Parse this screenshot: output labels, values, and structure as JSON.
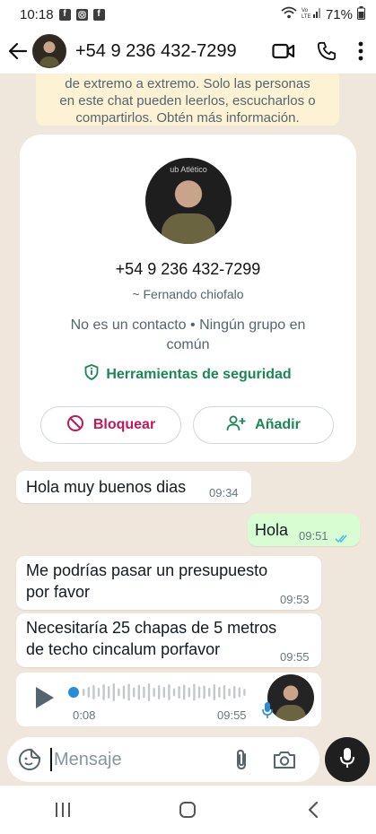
{
  "status_bar": {
    "time": "10:18",
    "battery": "71%"
  },
  "header": {
    "title": "+54 9 236 432-7299"
  },
  "encryption_notice": {
    "lines": [
      "de extremo a extremo. Solo las personas",
      "en este chat pueden leerlos, escucharlos o",
      "compartirlos. Obtén más información."
    ]
  },
  "contact_card": {
    "phone": "+54 9 236 432-7299",
    "name": "~ Fernando chiofalo",
    "info": "No es un contacto • Ningún grupo en común",
    "safety": "Herramientas de seguridad",
    "block_label": "Bloquear",
    "add_label": "Añadir"
  },
  "messages": [
    {
      "direction": "in",
      "text": "Hola muy buenos dias",
      "time": "09:34"
    },
    {
      "direction": "out",
      "text": "Hola",
      "time": "09:51",
      "status": "read"
    },
    {
      "direction": "in",
      "lines": [
        "Me podrías pasar un presupuesto",
        "por favor"
      ],
      "time": "09:53"
    },
    {
      "direction": "in",
      "lines": [
        "Necesitaría 25 chapas de 5 metros",
        "de techo cincalum porfavor"
      ],
      "time": "09:55"
    }
  ],
  "voice_message": {
    "duration": "0:08",
    "time": "09:55",
    "progress": 0
  },
  "composer": {
    "placeholder": "Mensaje"
  },
  "colors": {
    "accent_green": "#1b8755",
    "block_red": "#c2185b",
    "outgoing_bubble": "#d9fdd3",
    "read_tick": "#53bdeb"
  }
}
